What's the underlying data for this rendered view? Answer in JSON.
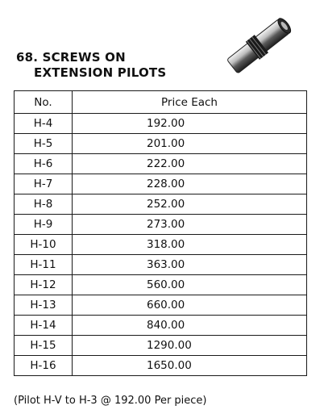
{
  "section": {
    "number_title": "68. SCREWS ON",
    "title_line2": "EXTENSION PILOTS"
  },
  "table": {
    "headers": [
      "No.",
      "Price Each"
    ],
    "rows": [
      {
        "no": "H-4",
        "price": "192.00"
      },
      {
        "no": "H-5",
        "price": "201.00"
      },
      {
        "no": "H-6",
        "price": "222.00"
      },
      {
        "no": "H-7",
        "price": "228.00"
      },
      {
        "no": "H-8",
        "price": "252.00"
      },
      {
        "no": "H-9",
        "price": "273.00"
      },
      {
        "no": "H-10",
        "price": "318.00"
      },
      {
        "no": "H-11",
        "price": "363.00"
      },
      {
        "no": "H-12",
        "price": "560.00"
      },
      {
        "no": "H-13",
        "price": "660.00"
      },
      {
        "no": "H-14",
        "price": "840.00"
      },
      {
        "no": "H-15",
        "price": "1290.00"
      },
      {
        "no": "H-16",
        "price": "1650.00"
      }
    ]
  },
  "footnote": "(Pilot H-V to H-3 @ 192.00 Per piece)",
  "image": {
    "icon": "extension-pilot-screw-icon"
  }
}
